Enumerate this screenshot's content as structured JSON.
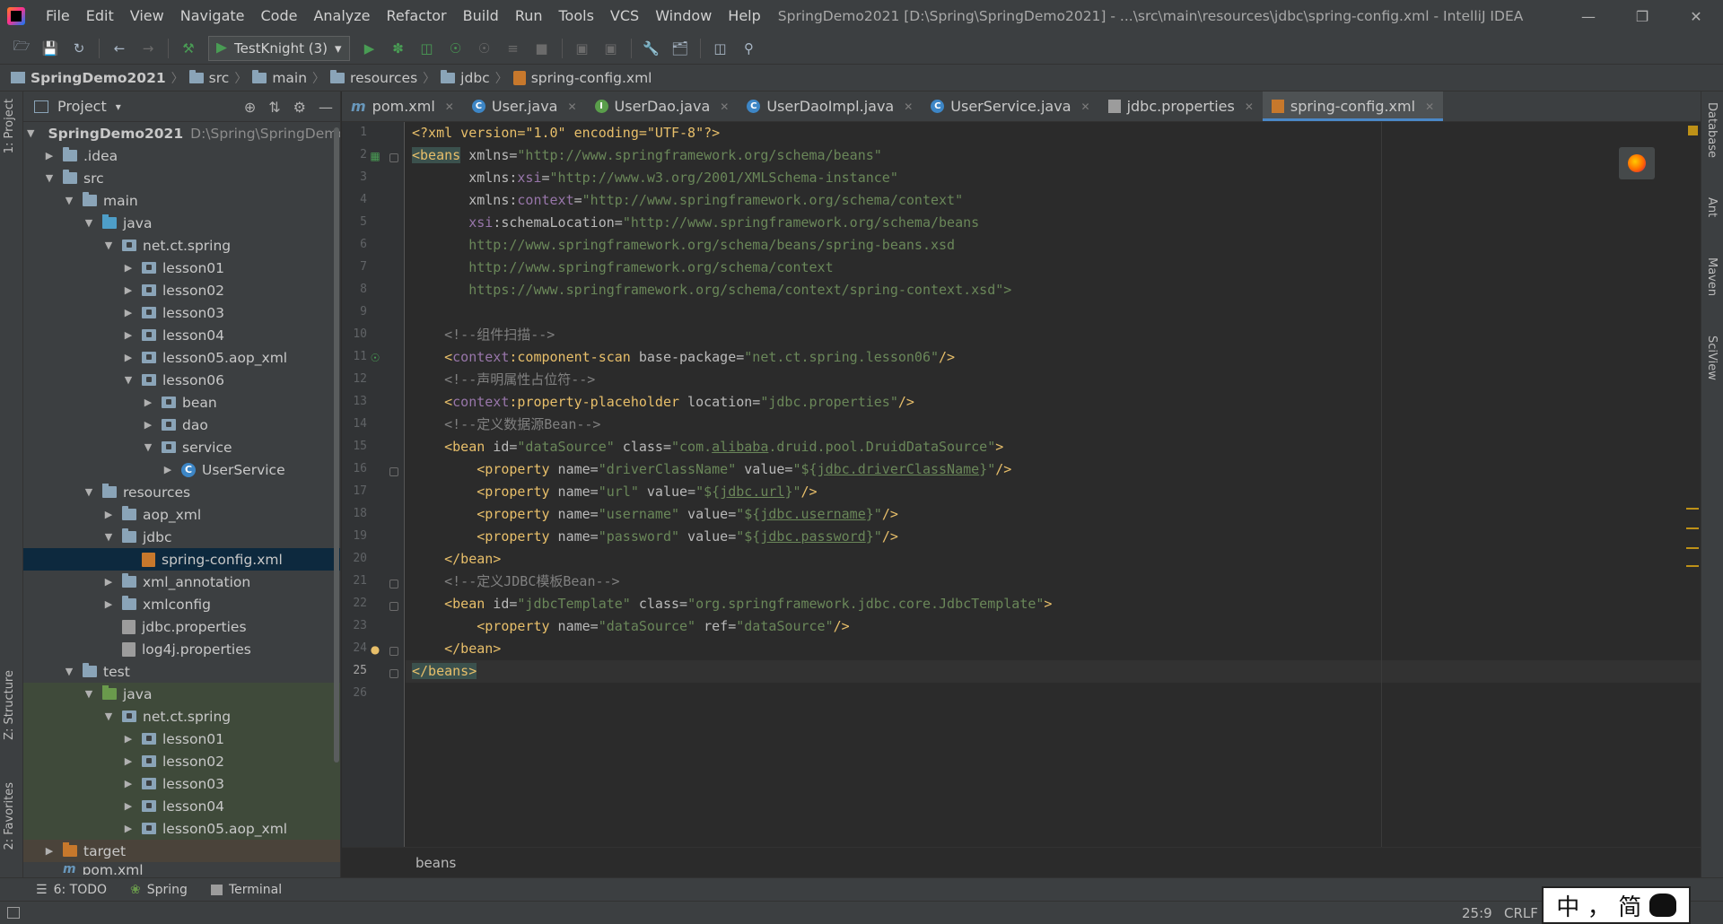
{
  "window": {
    "title": "SpringDemo2021 [D:\\Spring\\SpringDemo2021] - ...\\src\\main\\resources\\jdbc\\spring-config.xml - IntelliJ IDEA",
    "controls": {
      "minimize": "—",
      "restore": "❐",
      "close": "✕"
    }
  },
  "menu": [
    "File",
    "Edit",
    "View",
    "Navigate",
    "Code",
    "Analyze",
    "Refactor",
    "Build",
    "Run",
    "Tools",
    "VCS",
    "Window",
    "Help"
  ],
  "toolbar": {
    "run_config": "TestKnight (3)"
  },
  "breadcrumb": [
    "SpringDemo2021",
    "src",
    "main",
    "resources",
    "jdbc",
    "spring-config.xml"
  ],
  "left_strip": {
    "project_tab": "1: Project",
    "structure_tab": "Z: Structure",
    "favorites_tab": "2: Favorites"
  },
  "right_strip": {
    "database": "Database",
    "ant": "Ant",
    "maven": "Maven",
    "sciview": "SciView"
  },
  "project_panel": {
    "title": "Project",
    "tree": [
      {
        "label": "SpringDemo2021",
        "hint": "D:\\Spring\\SpringDemo",
        "bold": true
      },
      {
        "label": ".idea"
      },
      {
        "label": "src"
      },
      {
        "label": "main"
      },
      {
        "label": "java"
      },
      {
        "label": "net.ct.spring"
      },
      {
        "label": "lesson01"
      },
      {
        "label": "lesson02"
      },
      {
        "label": "lesson03"
      },
      {
        "label": "lesson04"
      },
      {
        "label": "lesson05.aop_xml"
      },
      {
        "label": "lesson06"
      },
      {
        "label": "bean"
      },
      {
        "label": "dao"
      },
      {
        "label": "service"
      },
      {
        "label": "UserService"
      },
      {
        "label": "resources"
      },
      {
        "label": "aop_xml"
      },
      {
        "label": "jdbc"
      },
      {
        "label": "spring-config.xml"
      },
      {
        "label": "xml_annotation"
      },
      {
        "label": "xmlconfig"
      },
      {
        "label": "jdbc.properties"
      },
      {
        "label": "log4j.properties"
      },
      {
        "label": "test"
      },
      {
        "label": "java"
      },
      {
        "label": "net.ct.spring"
      },
      {
        "label": "lesson01"
      },
      {
        "label": "lesson02"
      },
      {
        "label": "lesson03"
      },
      {
        "label": "lesson04"
      },
      {
        "label": "lesson05.aop_xml"
      },
      {
        "label": "target"
      },
      {
        "label": "pom.xml"
      }
    ]
  },
  "tabs": [
    {
      "label": "pom.xml",
      "icon": "m"
    },
    {
      "label": "User.java",
      "icon": "c"
    },
    {
      "label": "UserDao.java",
      "icon": "i"
    },
    {
      "label": "UserDaoImpl.java",
      "icon": "c"
    },
    {
      "label": "UserService.java",
      "icon": "c"
    },
    {
      "label": "jdbc.properties",
      "icon": "p"
    },
    {
      "label": "spring-config.xml",
      "icon": "x",
      "active": true
    }
  ],
  "editor": {
    "line_numbers": [
      "1",
      "2",
      "3",
      "4",
      "5",
      "6",
      "7",
      "8",
      "9",
      "10",
      "11",
      "12",
      "13",
      "14",
      "15",
      "16",
      "17",
      "18",
      "19",
      "20",
      "21",
      "22",
      "23",
      "24",
      "25",
      "26"
    ],
    "current_line": "25",
    "lines": {
      "l1_a": "<?xml version=\"1.0\" encoding=\"UTF-8\"?>",
      "l2_tag": "<beans",
      "l2_attr": " xmlns=",
      "l2_val": "\"http://www.springframework.org/schema/beans\"",
      "l3_attr": "xmlns:",
      "l3_ns": "xsi",
      "l3_eq": "=",
      "l3_val": "\"http://www.w3.org/2001/XMLSchema-instance\"",
      "l4_attr": "xmlns:",
      "l4_ns": "context",
      "l4_eq": "=",
      "l4_val": "\"http://www.springframework.org/schema/context\"",
      "l5_ns": "xsi",
      "l5_attr": ":schemaLocation=",
      "l5_val": "\"http://www.springframework.org/schema/beans",
      "l6_val": "http://www.springframework.org/schema/beans/spring-beans.xsd",
      "l7_val": "http://www.springframework.org/schema/context",
      "l8_val": "https://www.springframework.org/schema/context/spring-context.xsd\">",
      "l10_comment": "<!--组件扫描-->",
      "l11_tag_a": "<",
      "l11_ns": "context",
      "l11_tag_b": ":component-scan",
      "l11_attr": " base-package=",
      "l11_val": "\"net.ct.spring.lesson06\"",
      "l11_end": "/>",
      "l12_comment": "<!--声明属性占位符-->",
      "l13_tag_a": "<",
      "l13_ns": "context",
      "l13_tag_b": ":property-placeholder",
      "l13_attr": " location=",
      "l13_val": "\"jdbc.properties\"",
      "l13_end": "/>",
      "l14_comment": "<!--定义数据源Bean-->",
      "l15_tag": "<bean",
      "l15_attr1": " id=",
      "l15_val1": "\"dataSource\"",
      "l15_attr2": " class=",
      "l15_val2a": "\"com.",
      "l15_val2u": "alibaba",
      "l15_val2b": ".druid.pool.DruidDataSource\"",
      "l15_end": ">",
      "l16_tag": "<property",
      "l16_attr1": " name=",
      "l16_val1": "\"driverClassName\"",
      "l16_attr2": " value=",
      "l16_val2a": "\"${",
      "l16_val2u": "jdbc.driverClassName",
      "l16_val2b": "}\"",
      "l16_end": "/>",
      "l17_tag": "<property",
      "l17_attr1": " name=",
      "l17_val1": "\"url\"",
      "l17_attr2": " value=",
      "l17_val2a": "\"${",
      "l17_val2u": "jdbc.url",
      "l17_val2b": "}\"",
      "l17_end": "/>",
      "l18_tag": "<property",
      "l18_attr1": " name=",
      "l18_val1": "\"username\"",
      "l18_attr2": " value=",
      "l18_val2a": "\"${",
      "l18_val2u": "jdbc.username",
      "l18_val2b": "}\"",
      "l18_end": "/>",
      "l19_tag": "<property",
      "l19_attr1": " name=",
      "l19_val1": "\"password\"",
      "l19_attr2": " value=",
      "l19_val2a": "\"${",
      "l19_val2u": "jdbc.password",
      "l19_val2b": "}\"",
      "l19_end": "/>",
      "l20_tag": "</bean>",
      "l21_comment": "<!--定义JDBC模板Bean-->",
      "l22_tag": "<bean",
      "l22_attr1": " id=",
      "l22_val1": "\"jdbcTemplate\"",
      "l22_attr2": " class=",
      "l22_val2": "\"org.springframework.jdbc.core.JdbcTemplate\"",
      "l22_end": ">",
      "l23_tag": "<property",
      "l23_attr1": " name=",
      "l23_val1": "\"dataSource\"",
      "l23_attr2": " ref=",
      "l23_val2": "\"dataSource\"",
      "l23_end": "/>",
      "l24_tag": "</bean>",
      "l25_tag": "</beans>"
    },
    "breadcrumb_footer": "beans"
  },
  "bottom_tools": [
    {
      "label": "6: TODO"
    },
    {
      "label": "Spring"
    },
    {
      "label": "Terminal"
    }
  ],
  "status": {
    "position": "25:9",
    "line_sep": "CRLF"
  },
  "ime": {
    "char1": "中",
    "char2": "，",
    "char3": "简"
  },
  "colors": {
    "background": "#2b2b2b",
    "panel": "#3c3f41",
    "xml_tag": "#e8bf6a",
    "xml_value": "#6a8759",
    "xml_namespace": "#9876aa",
    "comment": "#808080",
    "accent": "#4a88c7"
  }
}
